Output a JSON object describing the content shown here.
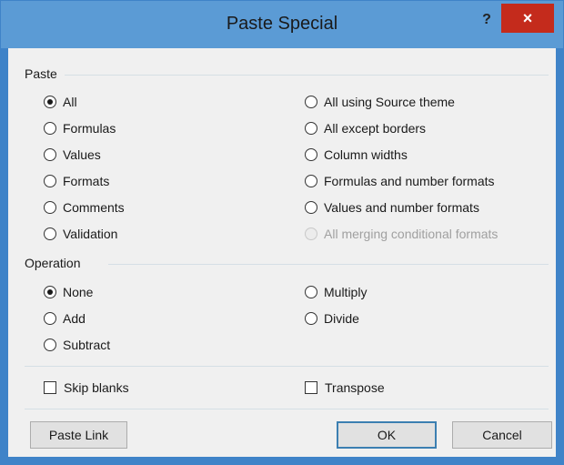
{
  "window": {
    "title": "Paste Special",
    "help_label": "?",
    "close_label": "×"
  },
  "paste": {
    "label": "Paste",
    "left": [
      {
        "label": "All",
        "checked": true
      },
      {
        "label": "Formulas",
        "checked": false
      },
      {
        "label": "Values",
        "checked": false
      },
      {
        "label": "Formats",
        "checked": false
      },
      {
        "label": "Comments",
        "checked": false
      },
      {
        "label": "Validation",
        "checked": false
      }
    ],
    "right": [
      {
        "label": "All using Source theme",
        "checked": false
      },
      {
        "label": "All except borders",
        "checked": false
      },
      {
        "label": "Column widths",
        "checked": false
      },
      {
        "label": "Formulas and number formats",
        "checked": false
      },
      {
        "label": "Values and number formats",
        "checked": false
      },
      {
        "label": "All merging conditional formats",
        "checked": false,
        "disabled": true
      }
    ]
  },
  "operation": {
    "label": "Operation",
    "left": [
      {
        "label": "None",
        "checked": true
      },
      {
        "label": "Add",
        "checked": false
      },
      {
        "label": "Subtract",
        "checked": false
      }
    ],
    "right": [
      {
        "label": "Multiply",
        "checked": false
      },
      {
        "label": "Divide",
        "checked": false
      }
    ]
  },
  "options": {
    "skip_blanks": {
      "label": "Skip blanks",
      "checked": false
    },
    "transpose": {
      "label": "Transpose",
      "checked": false
    }
  },
  "buttons": {
    "paste_link": "Paste Link",
    "ok": "OK",
    "cancel": "Cancel"
  },
  "colors": {
    "title_bar": "#5b9bd5",
    "close_button": "#c42b1c",
    "dialog_bg": "#f0f0f0"
  }
}
